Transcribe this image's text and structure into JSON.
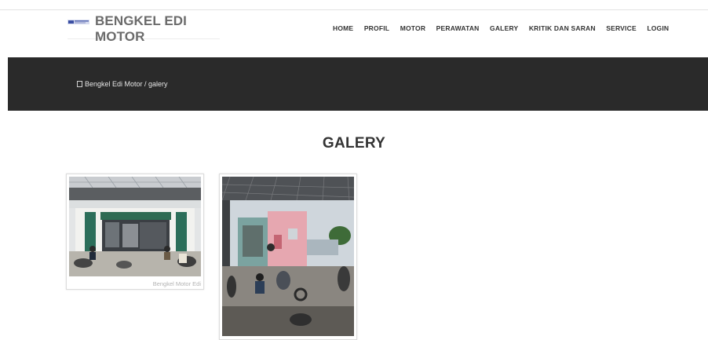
{
  "site": {
    "title": "BENGKEL EDI MOTOR"
  },
  "nav": {
    "items": [
      {
        "label": "HOME",
        "name": "nav-item-home"
      },
      {
        "label": "PROFIL",
        "name": "nav-item-profil"
      },
      {
        "label": "MOTOR",
        "name": "nav-item-motor"
      },
      {
        "label": "PERAWATAN",
        "name": "nav-item-perawatan"
      },
      {
        "label": "GALERY",
        "name": "nav-item-galery"
      },
      {
        "label": "KRITIK DAN SARAN",
        "name": "nav-item-kritik-dan-saran"
      },
      {
        "label": "SERVICE",
        "name": "nav-item-service"
      },
      {
        "label": "LOGIN",
        "name": "nav-item-login"
      }
    ]
  },
  "breadcrumb": {
    "icon": "home-icon",
    "text": "Bengkel Edi Motor / galery"
  },
  "page": {
    "title": "GALERY"
  },
  "gallery": {
    "items": [
      {
        "caption": "Bengkel Motor Edi"
      },
      {
        "caption": ""
      }
    ]
  },
  "colors": {
    "band": "#2a2a2a",
    "text": "#333333",
    "brand": "#6b6b6b"
  }
}
